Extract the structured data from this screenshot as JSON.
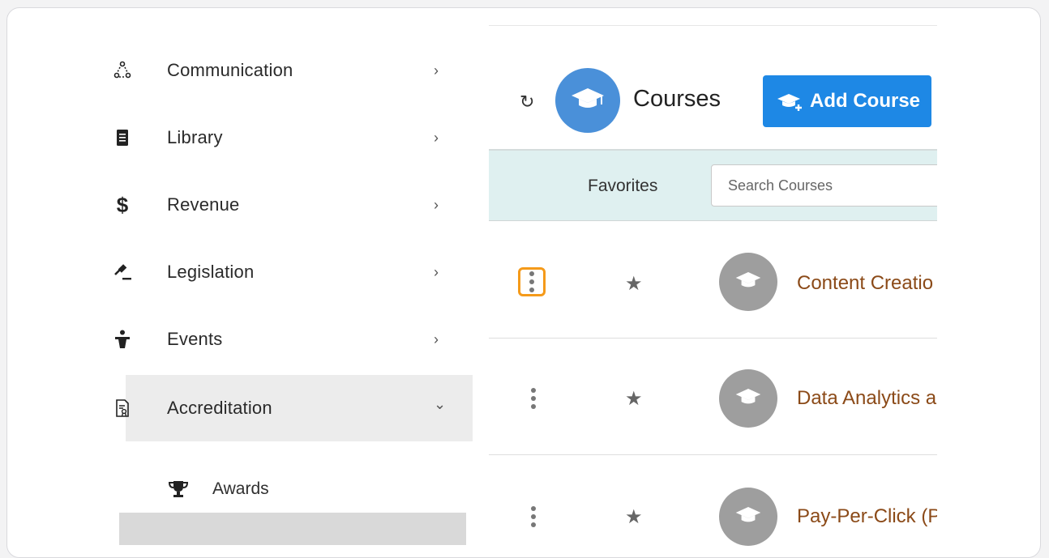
{
  "sidebar": {
    "items": [
      {
        "label": "Communication",
        "icon": "communication-icon",
        "chevron": "›"
      },
      {
        "label": "Library",
        "icon": "library-icon",
        "chevron": "›"
      },
      {
        "label": "Revenue",
        "icon": "dollar-icon",
        "chevron": "›"
      },
      {
        "label": "Legislation",
        "icon": "gavel-icon",
        "chevron": "›"
      },
      {
        "label": "Events",
        "icon": "podium-icon",
        "chevron": "›"
      },
      {
        "label": "Accreditation",
        "icon": "certificate-icon",
        "chevron": "⌄"
      }
    ],
    "sub_items": [
      {
        "label": "Awards",
        "icon": "trophy-icon"
      }
    ],
    "revenue_symbol": "$"
  },
  "main": {
    "title": "Courses",
    "add_button": "Add Course",
    "favorites_label": "Favorites",
    "search_placeholder": "Search Courses",
    "rows": [
      {
        "title": "Content Creatio"
      },
      {
        "title": "Data Analytics a"
      },
      {
        "title": "Pay-Per-Click (P"
      }
    ],
    "refresh_glyph": "↻",
    "star_glyph": "★"
  },
  "colors": {
    "accent_blue": "#1e88e5",
    "avatar_blue": "#4a90d9",
    "highlight_orange": "#f59a1a",
    "course_title": "#8b4a18",
    "filter_bg": "#dff0f0"
  }
}
